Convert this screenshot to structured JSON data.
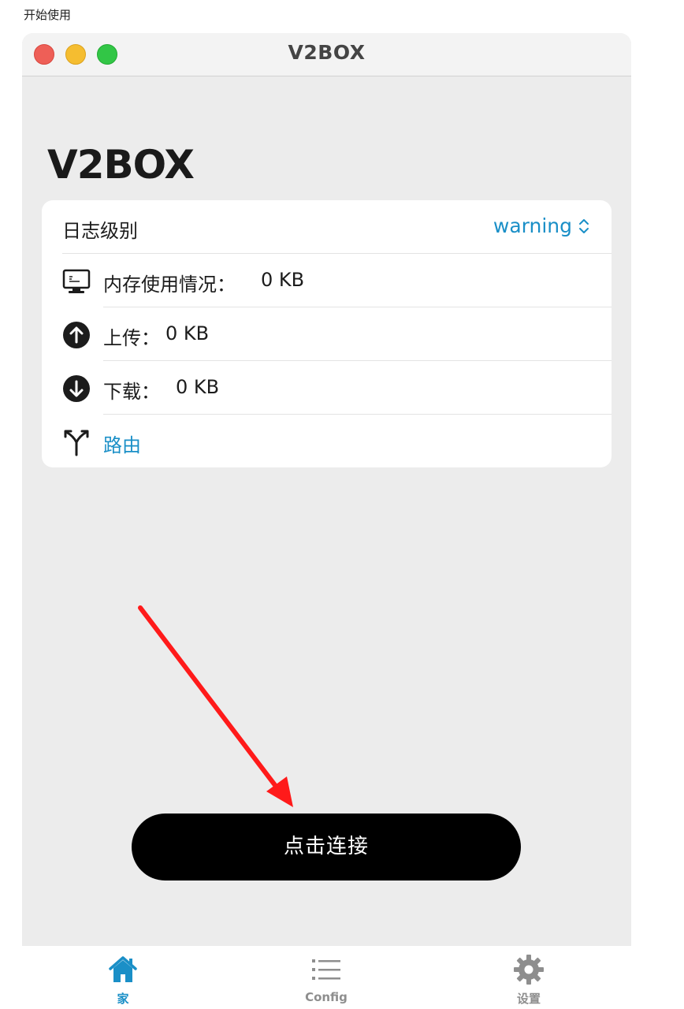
{
  "page": {
    "caption": "开始使用"
  },
  "window": {
    "title": "V2BOX"
  },
  "app": {
    "title": "V2BOX"
  },
  "status": {
    "log_level_label": "日志级别",
    "log_level_value": "warning",
    "memory_label": "内存使用情况：",
    "memory_value": "0 KB",
    "upload_label": "上传：",
    "upload_value": "0 KB",
    "download_label": "下载：",
    "download_value": "0 KB",
    "routing_label": "路由"
  },
  "action": {
    "connect_label": "点击连接"
  },
  "tabbar": {
    "tabs": [
      {
        "label": "家",
        "icon": "house-icon",
        "active": true
      },
      {
        "label": "Config",
        "icon": "list-icon",
        "active": false
      },
      {
        "label": "设置",
        "icon": "gear-icon",
        "active": false
      }
    ]
  },
  "colors": {
    "accent": "#1a8fc7",
    "annotation_arrow": "#ff1a1a",
    "button_bg": "#000000"
  }
}
